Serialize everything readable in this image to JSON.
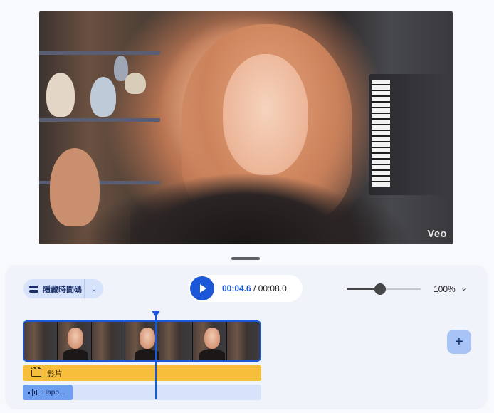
{
  "preview": {
    "watermark": "Veo"
  },
  "toolbar": {
    "timecode_toggle_label": "隱藏時間碼",
    "current_time": "00:04.6",
    "time_separator": "/",
    "total_time": "00:08.0",
    "zoom_level": "100%",
    "zoom_slider_value": 0.45
  },
  "tracks": {
    "video_clip_label": "影片",
    "audio_clip_label": "Happ..."
  },
  "playhead_position_seconds": 4.6,
  "colors": {
    "accent": "#1b57d6",
    "video_track": "#f6be3a",
    "audio_clip": "#6f9ff0",
    "audio_track": "#d7e2fb"
  },
  "icons": {
    "timecode": "timecode-icon",
    "dropdown": "chevron-down-icon",
    "play": "play-icon",
    "clip": "clapperboard-icon",
    "audio": "audio-wave-icon",
    "add": "plus-icon"
  }
}
